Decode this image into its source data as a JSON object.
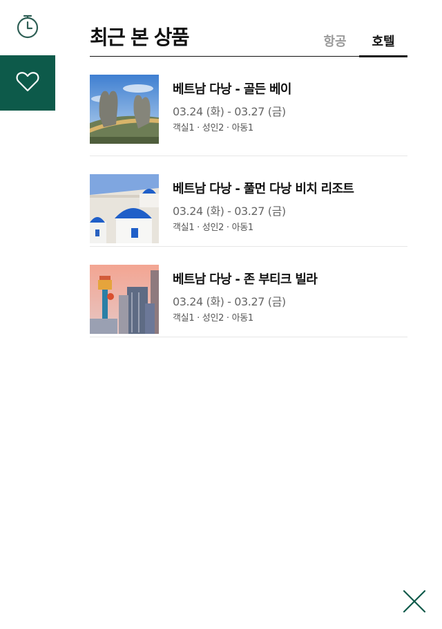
{
  "side_menu": {
    "recent_icon": "timer-icon",
    "wish_icon": "heart-icon",
    "accent_color": "#0d5a4a"
  },
  "header": {
    "title": "최근 본 상품",
    "tabs": [
      {
        "label": "항공",
        "active": false
      },
      {
        "label": "호텔",
        "active": true
      }
    ]
  },
  "items": [
    {
      "name": "베트남 다낭 - 골든 베이",
      "dates": "03.24 (화) - 03.27 (금)",
      "guests": "객실1 · 성인2 · 아동1"
    },
    {
      "name": "베트남 다낭 - 풀먼 다낭 비치 리조트",
      "dates": "03.24 (화) - 03.27 (금)",
      "guests": "객실1 · 성인2 · 아동1"
    },
    {
      "name": "베트남 다낭 - 존 부티크 빌라",
      "dates": "03.24 (화) - 03.27 (금)",
      "guests": "객실1 · 성인2 · 아동1"
    }
  ],
  "close_icon": "close-icon"
}
